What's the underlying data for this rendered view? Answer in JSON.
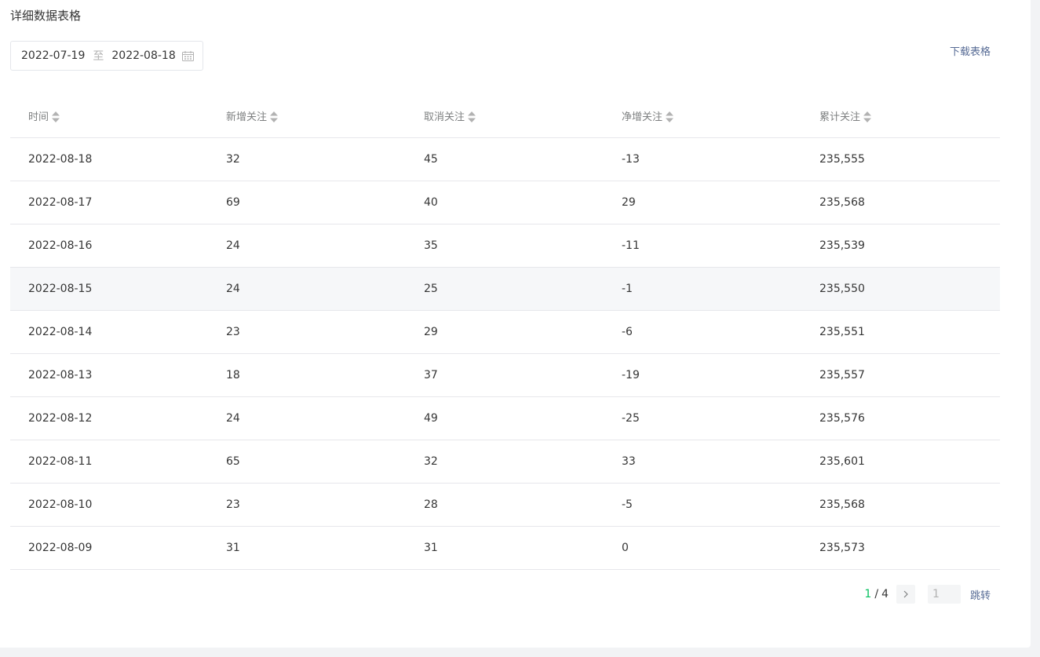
{
  "section": {
    "title": "详细数据表格"
  },
  "date_range": {
    "start": "2022-07-19",
    "separator": "至",
    "end": "2022-08-18"
  },
  "actions": {
    "download": "下载表格"
  },
  "table": {
    "headers": [
      "时间",
      "新增关注",
      "取消关注",
      "净增关注",
      "累计关注"
    ],
    "rows": [
      [
        "2022-08-18",
        "32",
        "45",
        "-13",
        "235,555"
      ],
      [
        "2022-08-17",
        "69",
        "40",
        "29",
        "235,568"
      ],
      [
        "2022-08-16",
        "24",
        "35",
        "-11",
        "235,539"
      ],
      [
        "2022-08-15",
        "24",
        "25",
        "-1",
        "235,550"
      ],
      [
        "2022-08-14",
        "23",
        "29",
        "-6",
        "235,551"
      ],
      [
        "2022-08-13",
        "18",
        "37",
        "-19",
        "235,557"
      ],
      [
        "2022-08-12",
        "24",
        "49",
        "-25",
        "235,576"
      ],
      [
        "2022-08-11",
        "65",
        "32",
        "33",
        "235,601"
      ],
      [
        "2022-08-10",
        "23",
        "28",
        "-5",
        "235,568"
      ],
      [
        "2022-08-09",
        "31",
        "31",
        "0",
        "235,573"
      ]
    ],
    "highlighted_row": 3
  },
  "pagination": {
    "current": "1",
    "separator": "/",
    "total": "4",
    "jump_value": "1",
    "jump_label": "跳转"
  },
  "colors": {
    "accent": "#07c160",
    "link": "#576b95"
  }
}
